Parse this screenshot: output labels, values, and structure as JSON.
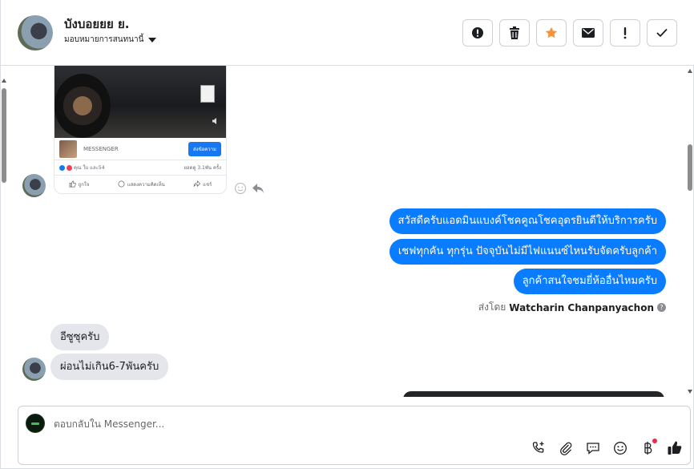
{
  "header": {
    "contact_name": "บังบอยยย ย.",
    "assign_label": "มอบหมายการสนทนานี้",
    "actions": [
      {
        "name": "spam",
        "icon": "exclamation-circle-icon"
      },
      {
        "name": "delete",
        "icon": "trash-icon"
      },
      {
        "name": "follow-up",
        "icon": "star-icon"
      },
      {
        "name": "mark-unread",
        "icon": "envelope-icon"
      },
      {
        "name": "priority",
        "icon": "exclamation-icon"
      },
      {
        "name": "done",
        "icon": "check-icon"
      }
    ]
  },
  "shared_post": {
    "messenger_label": "MESSENGER",
    "send_button": "ส่งข้อความ",
    "reactions_text": "คุณ ใบ และ54",
    "views_text": "ยอดดู 3.1พัน ครั้ง",
    "like_label": "ถูกใจ",
    "comment_label": "แสดงความคิดเห็น",
    "share_label": "แชร์"
  },
  "outgoing_messages": [
    "สวัสดีครับแอดมินแบงค์โชคคูณโชคอุดรยินดีให้บริการครับ",
    "เชฟทุกคัน ทุกรุ่น ปัจจุบันไม่มีไฟแนนซ์ไหนรับจัดครับลูกค้า",
    "ลูกค้าสนใจชมยี่ห้ออื่นไหมครับ"
  ],
  "sent_by": {
    "prefix": "ส่งโดย",
    "name": "Watcharin Chanpanyachon",
    "help": "?"
  },
  "incoming_messages": [
    "อีซูซุครับ",
    "ผ่อนไม่เกิน6-7พันครับ"
  ],
  "composer": {
    "placeholder": "ตอบกลับใน Messenger...",
    "tools": [
      "add-call-icon",
      "attachment-icon",
      "saved-replies-icon",
      "emoji-icon",
      "payment-icon",
      "like-icon"
    ]
  },
  "colors": {
    "outgoing_bubble": "#0a7cff",
    "incoming_bubble": "#e4e6eb",
    "star": "#f7923a"
  }
}
